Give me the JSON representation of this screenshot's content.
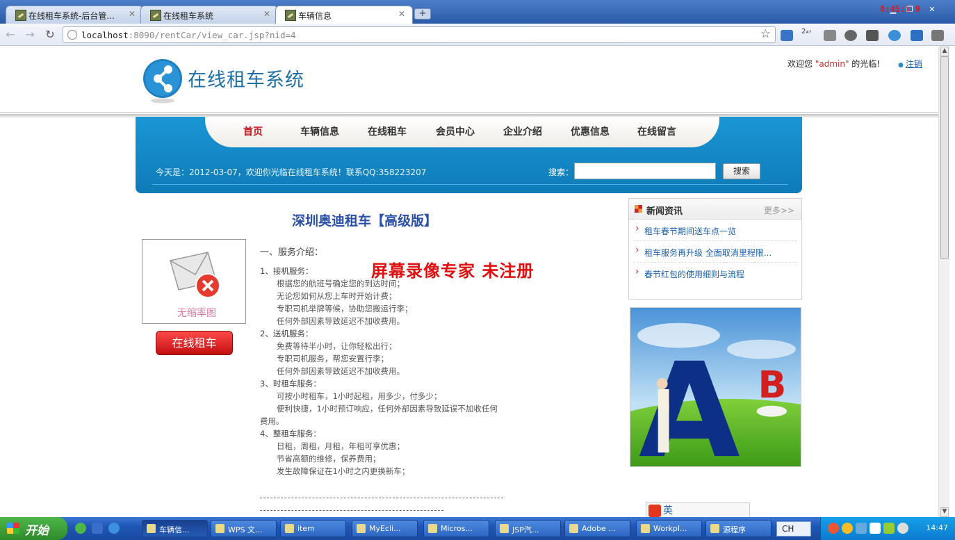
{
  "browser": {
    "tabs": [
      {
        "label": "在线租车系统-后台管..."
      },
      {
        "label": "在线租车系统"
      },
      {
        "label": "车辆信息"
      }
    ],
    "recording_time": "0:45:1:9",
    "url_host": "localhost",
    "url_rest": ":8090/rentCar/view_car.jsp?nid=4",
    "ext_badge": "2₄₇"
  },
  "header": {
    "logo_text": "在线租车系统",
    "welcome_prefix": "欢迎您 ",
    "welcome_user": "\"admin\"",
    "welcome_suffix": " 的光临!",
    "logout": "注销"
  },
  "nav": {
    "items": [
      "首页",
      "车辆信息",
      "在线租车",
      "会员中心",
      "企业介绍",
      "优惠信息",
      "在线留言"
    ],
    "active": "首页",
    "info_text": "今天是：2012-03-07，欢迎你光临在线租车系统！联系QQ:358223207",
    "search_label": "搜索：",
    "search_value": "",
    "search_button": "搜索"
  },
  "car": {
    "title": "深圳奥迪租车【高级版】",
    "thumb_caption": "无缩率图",
    "rent_button": "在线租车"
  },
  "content": {
    "heading": "一、服务介绍：",
    "sections": [
      {
        "title": "1、接机服务：",
        "lines": [
          "根据您的航班号确定您的到达时间；",
          "无论您如何从您上车时开始计费；",
          "专职司机举牌等候，协助您搬运行李；",
          "任何外部因素导致延迟不加收费用。"
        ]
      },
      {
        "title": "2、送机服务：",
        "lines": [
          "免费等待半小时，让你轻松出行；",
          "专职司机服务，帮您安置行李；",
          "任何外部因素导致延迟不加收费用。"
        ]
      },
      {
        "title": "3、时租车服务：",
        "lines": [
          "可按小时租车，1小时起租，用多少，付多少；",
          "便利快捷，1小时预订响应，任何外部因素导致延误不加收任何费用。"
        ]
      },
      {
        "title": "4、整租车服务：",
        "lines": [
          "日租，周租，月租，年租可享优惠；",
          "节省高额的维修，保养费用；",
          "发生故障保证在1小时之内更换新车；"
        ]
      }
    ]
  },
  "watermark": "屏幕录像专家  未注册",
  "news": {
    "title": "新闻资讯",
    "more": "更多>>",
    "items": [
      "租车春节期间送车点一览",
      "租车服务再升级 全面取消里程限...",
      "春节红包的使用细则与流程"
    ]
  },
  "ad": {
    "letter_a": "A",
    "letter_b": "B"
  },
  "ime": {
    "label": "英"
  },
  "taskbar": {
    "start": "开始",
    "tasks": [
      "车辆信...",
      "WPS 文...",
      "item",
      "MyEcli...",
      "Micros...",
      "JSP汽...",
      "Adobe ...",
      "Workpl...",
      "源程序"
    ],
    "lang": "CH",
    "clock": "14:47"
  }
}
